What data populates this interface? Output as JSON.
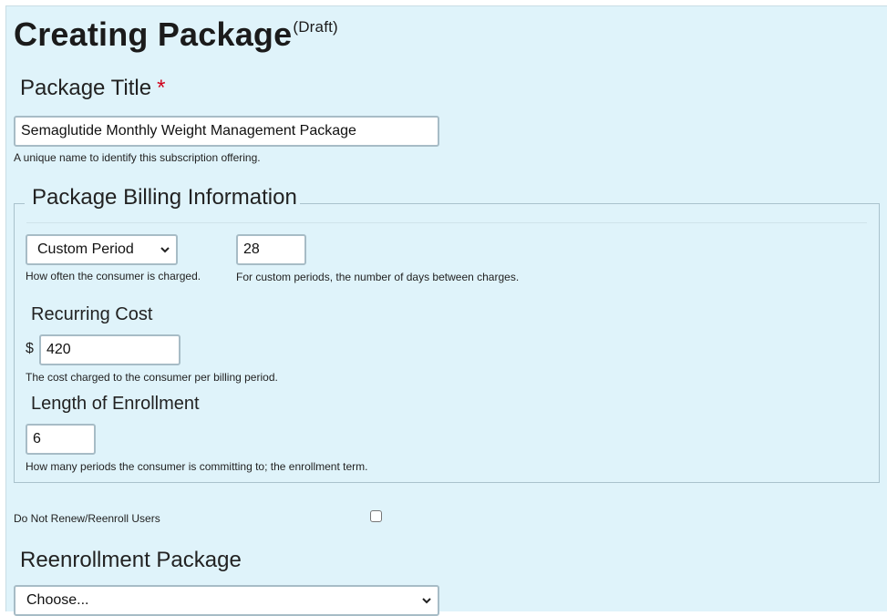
{
  "header": {
    "title": "Creating Package",
    "status": "(Draft)"
  },
  "package_title": {
    "label": "Package Title",
    "required_mark": "*",
    "value": "Semaglutide Monthly Weight Management Package",
    "help": "A unique name to identify this subscription offering."
  },
  "billing": {
    "legend": "Package Billing Information",
    "frequency": {
      "selected": "Custom Period",
      "help": "How often the consumer is charged."
    },
    "custom_days": {
      "value": "28",
      "help": "For custom periods, the number of days between charges."
    },
    "recurring_cost": {
      "label": "Recurring Cost",
      "currency_symbol": "$",
      "value": "420",
      "help": "The cost charged to the consumer per billing period."
    },
    "enrollment_length": {
      "label": "Length of Enrollment",
      "value": "6",
      "help": "How many periods the consumer is committing to; the enrollment term."
    }
  },
  "do_not_renew": {
    "label": "Do Not Renew/Reenroll Users",
    "checked": false
  },
  "reenrollment": {
    "label": "Reenrollment Package",
    "selected": "Choose..."
  },
  "icons": {
    "select_arrow": "chevron-down-icon"
  },
  "colors": {
    "page_background": "#dff3fa",
    "required": "#d0021b",
    "input_border": "#a7bcc6"
  }
}
